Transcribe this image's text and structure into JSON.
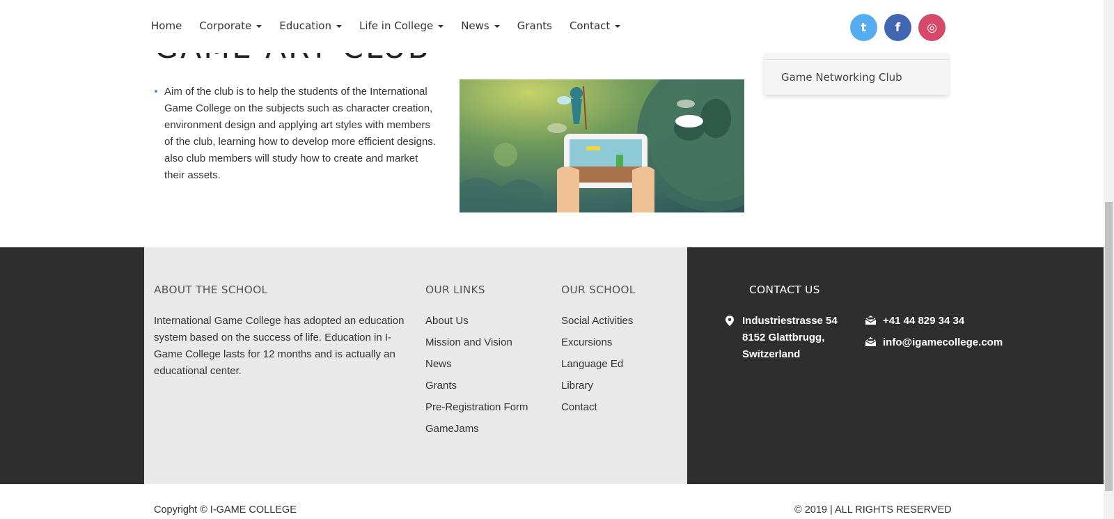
{
  "nav": {
    "items": [
      {
        "label": "Home",
        "dropdown": false
      },
      {
        "label": "Corporate",
        "dropdown": true
      },
      {
        "label": "Education",
        "dropdown": true
      },
      {
        "label": "Life in College",
        "dropdown": true
      },
      {
        "label": "News",
        "dropdown": true
      },
      {
        "label": "Grants",
        "dropdown": false
      },
      {
        "label": "Contact",
        "dropdown": true
      }
    ],
    "social": [
      {
        "icon": "twitter-icon",
        "glyph": "t",
        "color": "#55acee"
      },
      {
        "icon": "facebook-icon",
        "glyph": "f",
        "color": "#4267b2"
      },
      {
        "icon": "instagram-icon",
        "glyph": "◎",
        "color": "#d6496b"
      }
    ]
  },
  "page": {
    "title": "GAME ART CLUB",
    "bullet": "Aim of the club is to help the students of the International Game College on the subjects such as character creation, environment design and applying art styles with members of the club, learning how to develop more efficient designs. also club members will study how to create and market their assets."
  },
  "sidebar": {
    "items": [
      {
        "label": "Game Networking Club"
      }
    ]
  },
  "footer": {
    "about": {
      "heading": "ABOUT THE SCHOOL",
      "text": "International Game College has adopted an education system based on the success of life. Education in I-Game College lasts for 12 months and is actually an educational center."
    },
    "links": {
      "heading": "OUR LINKS",
      "items": [
        "About Us",
        "Mission and Vision",
        "News",
        "Grants",
        "Pre-Registration Form",
        "GameJams"
      ]
    },
    "school": {
      "heading": "OUR SCHOOL",
      "items": [
        "Social Activities",
        "Excursions",
        "Language Ed",
        "Library",
        "Contact"
      ]
    },
    "contact": {
      "heading": "CONTACT US",
      "address_line1": "Industriestrasse 54",
      "address_line2": "8152 Glattbrugg,",
      "address_line3": "Switzerland",
      "phone": "+41 44 829 34 34",
      "email": "info@igamecollege.com"
    },
    "copyright_left": "Copyright © I-GAME COLLEGE",
    "copyright_right": "© 2019 | ALL RIGHTS RESERVED"
  },
  "colors": {
    "footer_dark": "#2e2e2e",
    "footer_light": "#e9e9e9",
    "bullet_accent": "#5a8bd6"
  }
}
